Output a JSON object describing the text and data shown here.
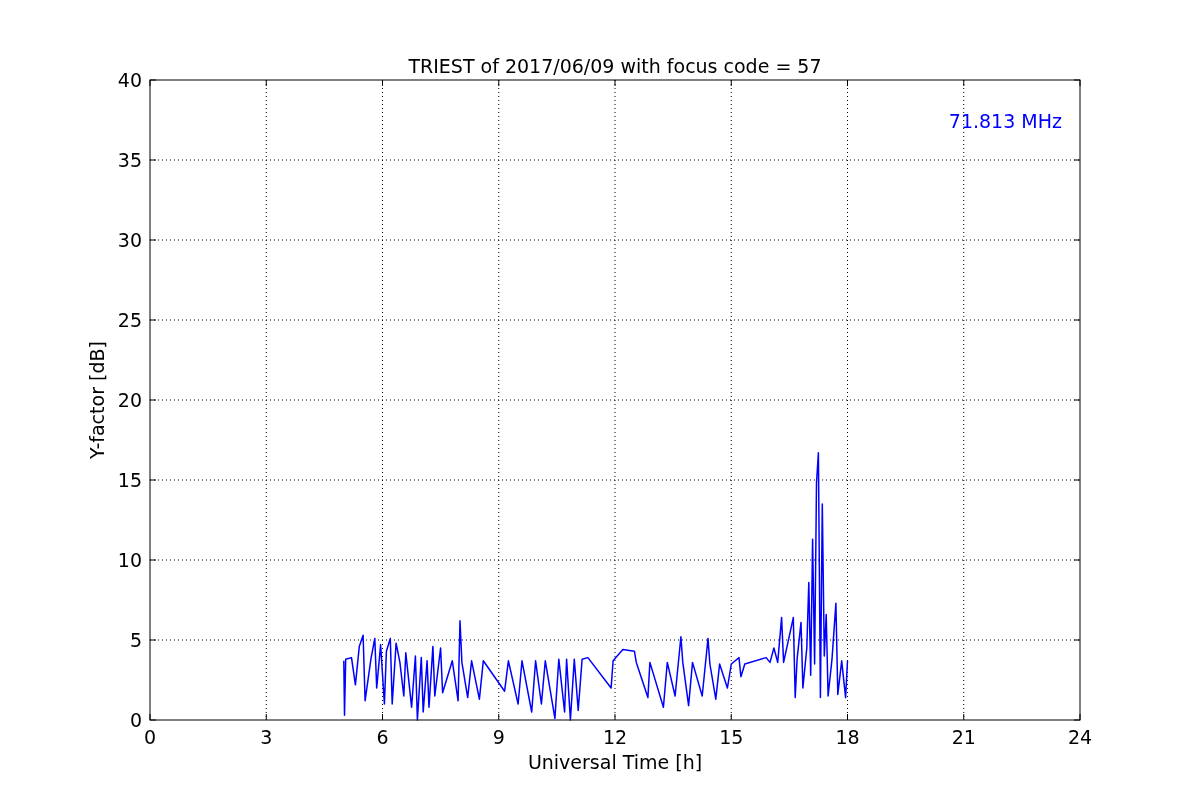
{
  "chart_data": {
    "type": "line",
    "title": "TRIEST of 2017/06/09 with focus code = 57",
    "xlabel": "Universal Time [h]",
    "ylabel": "Y-factor [dB]",
    "xlim": [
      0,
      24
    ],
    "ylim": [
      0,
      40
    ],
    "xticks": [
      0,
      3,
      6,
      9,
      12,
      15,
      18,
      21,
      24
    ],
    "yticks": [
      0,
      5,
      10,
      15,
      20,
      25,
      30,
      35,
      40
    ],
    "x": [
      5.0,
      5.02,
      5.05,
      5.2,
      5.3,
      5.4,
      5.5,
      5.55,
      5.7,
      5.8,
      5.85,
      5.95,
      6.05,
      6.1,
      6.2,
      6.25,
      6.35,
      6.45,
      6.55,
      6.6,
      6.75,
      6.85,
      6.9,
      7.0,
      7.05,
      7.15,
      7.2,
      7.3,
      7.35,
      7.5,
      7.55,
      7.8,
      7.95,
      8.0,
      8.05,
      8.2,
      8.3,
      8.5,
      8.6,
      9.15,
      9.25,
      9.5,
      9.6,
      9.85,
      9.95,
      10.1,
      10.2,
      10.45,
      10.55,
      10.7,
      10.75,
      10.85,
      10.95,
      11.05,
      11.15,
      11.3,
      11.9,
      11.95,
      12.2,
      12.5,
      12.55,
      12.85,
      12.9,
      13.25,
      13.35,
      13.55,
      13.7,
      13.75,
      13.9,
      14.0,
      14.25,
      14.4,
      14.45,
      14.6,
      14.7,
      14.9,
      15.0,
      15.2,
      15.25,
      15.35,
      15.9,
      16.0,
      16.1,
      16.2,
      16.3,
      16.35,
      16.6,
      16.65,
      16.7,
      16.8,
      16.85,
      16.95,
      17.0,
      17.05,
      17.1,
      17.15,
      17.2,
      17.25,
      17.3,
      17.35,
      17.4,
      17.45,
      17.5,
      17.6,
      17.7,
      17.75,
      17.85,
      17.95,
      18.0
    ],
    "series": [
      {
        "color": "#0000ff",
        "values": [
          3.7,
          0.3,
          3.8,
          3.9,
          2.2,
          4.6,
          5.3,
          1.2,
          3.8,
          5.1,
          2.0,
          4.7,
          1.0,
          4.3,
          5.1,
          1.0,
          4.8,
          3.6,
          1.5,
          4.2,
          0.8,
          4.0,
          0.0,
          3.9,
          0.5,
          3.7,
          0.8,
          4.6,
          1.5,
          4.5,
          1.7,
          3.7,
          1.2,
          6.2,
          3.6,
          1.4,
          3.7,
          1.3,
          3.7,
          1.8,
          3.7,
          1.0,
          3.7,
          0.5,
          3.7,
          1.0,
          3.7,
          0.1,
          3.8,
          0.5,
          3.8,
          0.0,
          3.8,
          0.6,
          3.8,
          3.9,
          2.0,
          3.7,
          4.4,
          4.3,
          3.6,
          1.4,
          3.6,
          0.8,
          3.6,
          1.5,
          5.2,
          3.6,
          0.9,
          3.6,
          1.5,
          5.1,
          3.5,
          1.3,
          3.5,
          2.0,
          3.5,
          3.9,
          2.7,
          3.5,
          3.9,
          3.6,
          4.5,
          3.6,
          6.4,
          3.6,
          6.4,
          1.4,
          3.8,
          6.1,
          2.0,
          4.5,
          8.6,
          2.8,
          11.3,
          3.5,
          14.8,
          16.7,
          1.4,
          13.5,
          4.0,
          6.6,
          1.5,
          3.8,
          7.3,
          1.6,
          3.7,
          1.4,
          3.7
        ]
      }
    ],
    "grid": true,
    "annotations": [
      "71.813 MHz"
    ]
  }
}
